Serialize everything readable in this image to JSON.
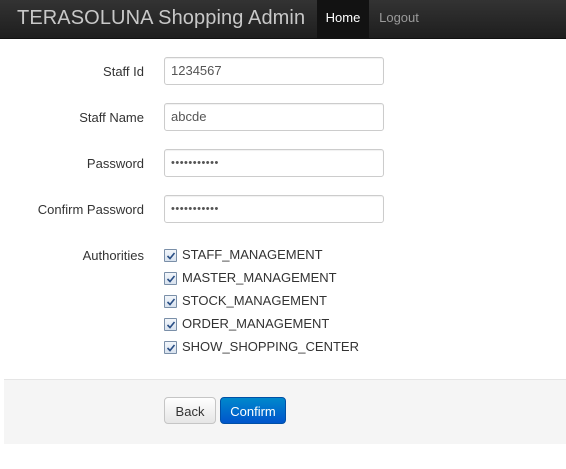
{
  "navbar": {
    "brand": "TERASOLUNA Shopping Admin",
    "items": [
      {
        "label": "Home",
        "active": true
      },
      {
        "label": "Logout",
        "active": false
      }
    ]
  },
  "form": {
    "staff_id": {
      "label": "Staff Id",
      "value": "1234567"
    },
    "staff_name": {
      "label": "Staff Name",
      "value": "abcde"
    },
    "password": {
      "label": "Password",
      "value": "•••••••••••"
    },
    "confirm_password": {
      "label": "Confirm Password",
      "value": "•••••••••••"
    },
    "authorities": {
      "label": "Authorities",
      "options": [
        {
          "label": "STAFF_MANAGEMENT",
          "checked": true
        },
        {
          "label": "MASTER_MANAGEMENT",
          "checked": true
        },
        {
          "label": "STOCK_MANAGEMENT",
          "checked": true
        },
        {
          "label": "ORDER_MANAGEMENT",
          "checked": true
        },
        {
          "label": "SHOW_SHOPPING_CENTER",
          "checked": true
        }
      ]
    }
  },
  "actions": {
    "back_label": "Back",
    "confirm_label": "Confirm"
  },
  "colors": {
    "navbar_bg": "#222222",
    "primary_button": "#006dcc"
  }
}
